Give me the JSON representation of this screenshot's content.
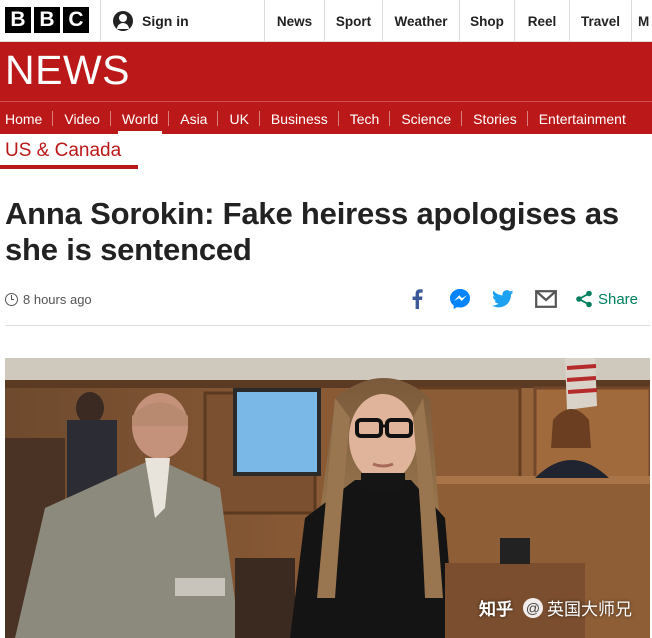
{
  "header": {
    "logo_letters": [
      "B",
      "B",
      "C"
    ],
    "signin_label": "Sign in",
    "nav": [
      "News",
      "Sport",
      "Weather",
      "Shop",
      "Reel",
      "Travel",
      "M"
    ]
  },
  "masthead": {
    "title": "NEWS",
    "sections": [
      "Home",
      "Video",
      "World",
      "Asia",
      "UK",
      "Business",
      "Tech",
      "Science",
      "Stories",
      "Entertainment"
    ],
    "active_section": "World"
  },
  "article": {
    "subsection": "US & Canada",
    "headline": "Anna Sorokin: Fake heiress apologises as she is sentenced",
    "timestamp": "8 hours ago",
    "share": {
      "icons": [
        "facebook-icon",
        "messenger-icon",
        "twitter-icon",
        "email-icon"
      ],
      "share_label": "Share"
    }
  },
  "watermark": {
    "logo": "知乎",
    "handle": "英国大师兄"
  },
  "colors": {
    "brand_red": "#bb1919",
    "facebook": "#3b5998",
    "messenger": "#0084ff",
    "twitter": "#1da1f2",
    "share_green": "#007f5f"
  }
}
